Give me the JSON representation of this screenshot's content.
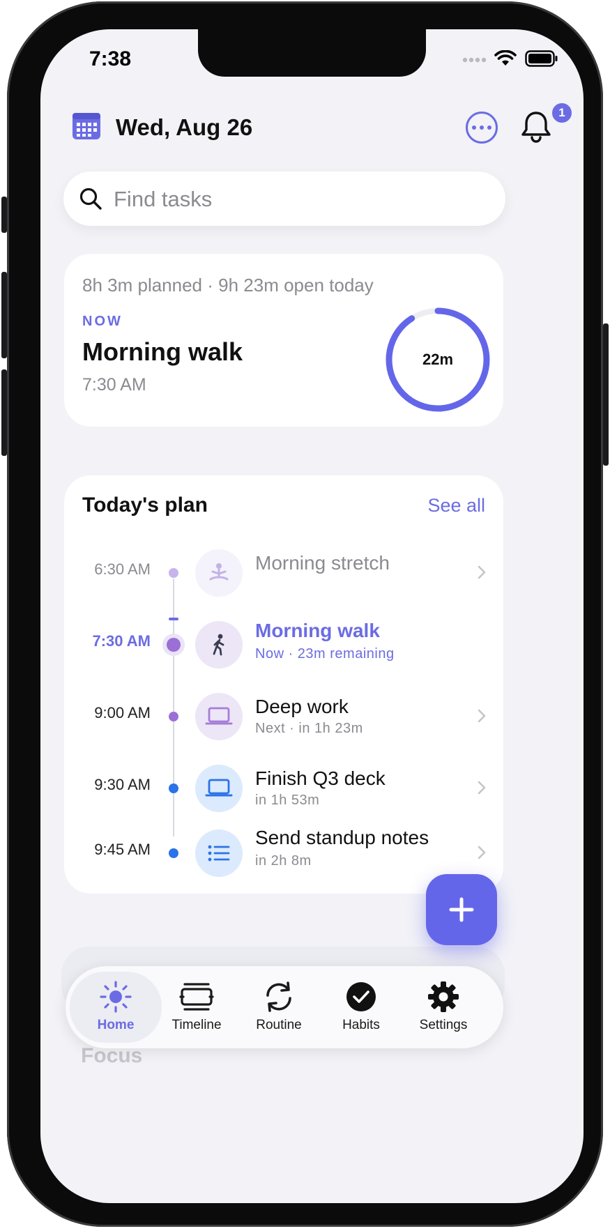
{
  "status_bar": {
    "time": "7:38"
  },
  "header": {
    "date": "Wed, Aug 26",
    "notification_count": "1"
  },
  "search": {
    "placeholder": "Find tasks"
  },
  "now_card": {
    "summary": "8h 3m planned · 9h 23m open today",
    "tag": "NOW",
    "title": "Morning walk",
    "time": "7:30 AM",
    "ring_label": "22m",
    "ring_progress": 0.91
  },
  "plan": {
    "title": "Today's plan",
    "see_all": "See all",
    "items": [
      {
        "time": "6:30 AM",
        "name": "Morning stretch",
        "sub": ""
      },
      {
        "time": "7:30 AM",
        "name": "Morning walk",
        "sub": "Now · 23m remaining"
      },
      {
        "time": "9:00 AM",
        "name": "Deep work",
        "sub": "Next · in 1h 23m"
      },
      {
        "time": "9:30 AM",
        "name": "Finish Q3 deck",
        "sub": "in 1h 53m"
      },
      {
        "time": "9:45 AM",
        "name": "Send standup notes",
        "sub": "in 2h 8m"
      }
    ]
  },
  "background_section": {
    "label": "Focus"
  },
  "tabbar": {
    "tabs": [
      {
        "label": "Home",
        "icon": "sun-icon"
      },
      {
        "label": "Timeline",
        "icon": "timeline-icon"
      },
      {
        "label": "Routine",
        "icon": "repeat-icon"
      },
      {
        "label": "Habits",
        "icon": "check-circle-icon"
      },
      {
        "label": "Settings",
        "icon": "gear-icon"
      }
    ]
  },
  "colors": {
    "accent": "#6b6ce3",
    "blue": "#2b73e8",
    "purple": "#9b6fd6"
  }
}
